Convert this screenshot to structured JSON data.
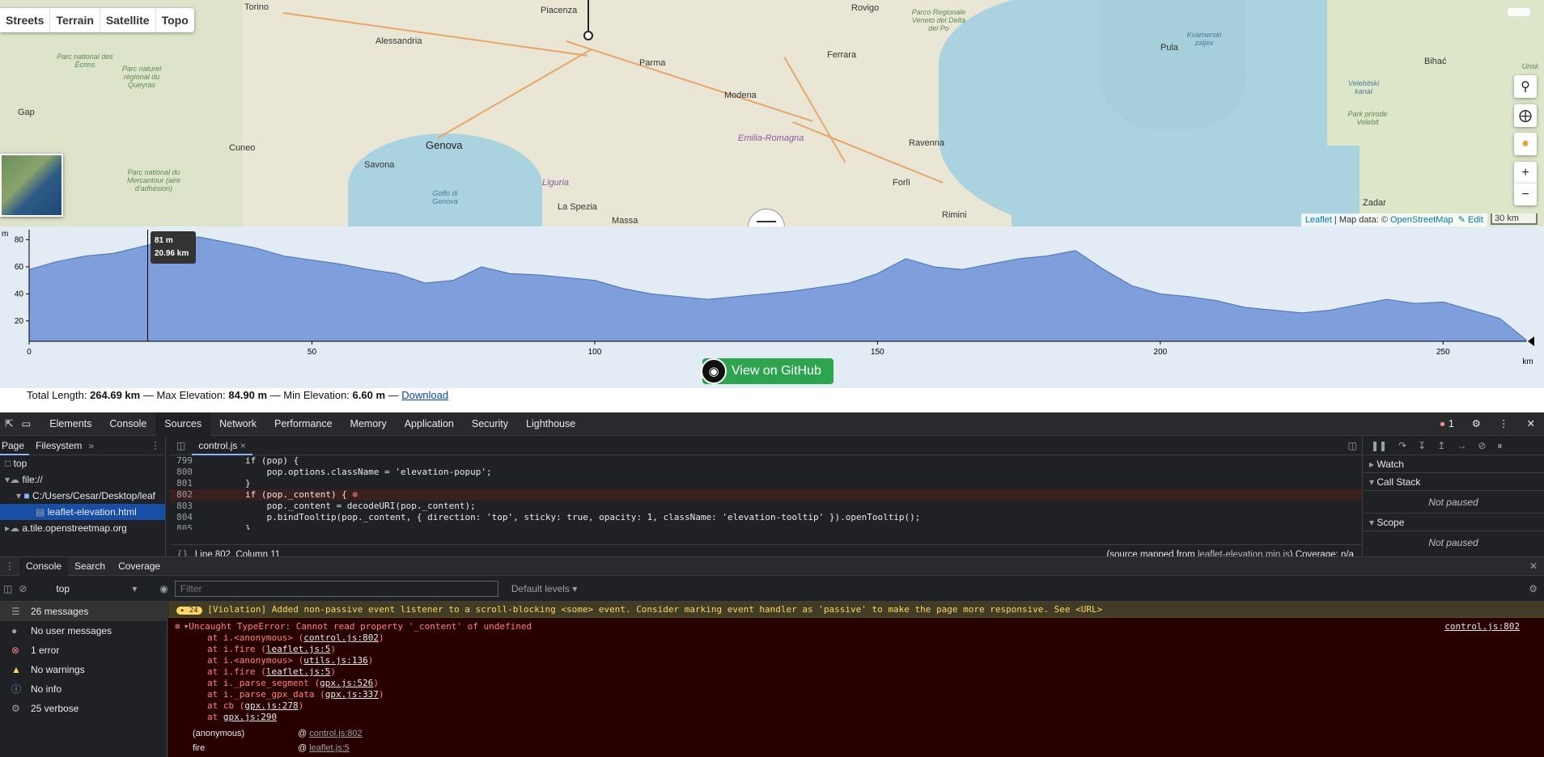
{
  "map": {
    "layers": [
      "Streets",
      "Terrain",
      "Satellite",
      "Topo"
    ],
    "cities": [
      {
        "name": "Torino"
      },
      {
        "name": "Piacenza"
      },
      {
        "name": "Rovigo"
      },
      {
        "name": "Alessandria"
      },
      {
        "name": "Parma"
      },
      {
        "name": "Ferrara"
      },
      {
        "name": "Modena"
      },
      {
        "name": "Genova"
      },
      {
        "name": "Ravenna"
      },
      {
        "name": "Savona"
      },
      {
        "name": "Cuneo"
      },
      {
        "name": "Forlì"
      },
      {
        "name": "La Spezia"
      },
      {
        "name": "Massa"
      },
      {
        "name": "Rimini"
      },
      {
        "name": "Pula"
      },
      {
        "name": "Zadar"
      },
      {
        "name": "Bihać"
      },
      {
        "name": "Gap"
      },
      {
        "name": "Emilia-Romagna"
      },
      {
        "name": "Liguria"
      }
    ],
    "parks": [
      "Parc national des Écrins",
      "Parc naturel régional du Queyras",
      "Parco Regionale Veneto del Delta del Po",
      "Parc national du Mercantour (aire d'adhésion)",
      "Golfo di Genova",
      "Kvarnerski zaljev",
      "Velebitski kanal",
      "Park prirode Velebit",
      "Unsk"
    ],
    "buttons": {
      "search": "search-icon",
      "locate": "locate-icon",
      "pegman": "pegman-icon",
      "zoom_in": "+",
      "zoom_out": "−"
    },
    "attribution": {
      "leaflet": "Leaflet",
      "sep1": " | Map data: © ",
      "osm": "OpenStreetMap",
      "edit": "✎ Edit"
    },
    "scale": "30 km"
  },
  "elevation": {
    "y_unit": "m",
    "x_unit": "km",
    "y_ticks": [
      "80",
      "60",
      "40",
      "20"
    ],
    "x_ticks": [
      "0",
      "50",
      "100",
      "150",
      "200",
      "250"
    ],
    "tooltip_elev": "81 m",
    "tooltip_dist": "20.96 km"
  },
  "chart_data": {
    "type": "area",
    "xlabel": "km",
    "ylabel": "m",
    "xlim": [
      0,
      264.69
    ],
    "ylim": [
      5,
      85
    ],
    "x": [
      0,
      5,
      10,
      15,
      20,
      25,
      30,
      35,
      40,
      45,
      50,
      55,
      60,
      65,
      70,
      75,
      80,
      85,
      90,
      95,
      100,
      105,
      110,
      115,
      120,
      125,
      130,
      135,
      140,
      145,
      150,
      155,
      160,
      165,
      170,
      175,
      180,
      185,
      190,
      195,
      200,
      205,
      210,
      215,
      220,
      225,
      230,
      235,
      240,
      245,
      250,
      255,
      260,
      264.69
    ],
    "y": [
      58,
      64,
      68,
      70,
      75,
      80,
      82,
      78,
      74,
      68,
      65,
      62,
      58,
      55,
      48,
      50,
      60,
      55,
      54,
      52,
      50,
      44,
      40,
      38,
      36,
      38,
      40,
      42,
      45,
      48,
      55,
      66,
      60,
      58,
      62,
      66,
      68,
      72,
      58,
      46,
      40,
      38,
      35,
      30,
      28,
      26,
      28,
      32,
      36,
      33,
      34,
      28,
      22,
      6
    ]
  },
  "github_button": "View on GitHub",
  "stats": {
    "total_label": "Total Length: ",
    "total": "264.69 km",
    "max_label": " — Max Elevation: ",
    "max": "84.90 m",
    "min_label": " — Min Elevation: ",
    "min": "6.60 m",
    "sep": " — ",
    "download": "Download"
  },
  "devtools": {
    "tabs": [
      "Elements",
      "Console",
      "Sources",
      "Network",
      "Performance",
      "Memory",
      "Application",
      "Security",
      "Lighthouse"
    ],
    "selected_tab": "Sources",
    "error_count": "1",
    "nav_tabs": [
      "Page",
      "Filesystem"
    ],
    "tree": [
      "top",
      "file://",
      "C:/Users/Cesar/Desktop/leaf",
      "leaflet-elevation.html",
      "a.tile.openstreetmap.org"
    ],
    "file_tab": "control.js",
    "code": [
      {
        "ln": "799",
        "text": "        if (pop) {"
      },
      {
        "ln": "800",
        "text": "            pop.options.className = 'elevation-popup';"
      },
      {
        "ln": "801",
        "text": "        }"
      },
      {
        "ln": "802",
        "text": "        if (pop._content) {"
      },
      {
        "ln": "803",
        "text": "            pop._content = decodeURI(pop._content);"
      },
      {
        "ln": "804",
        "text": "            p.bindTooltip(pop._content, { direction: 'top', sticky: true, opacity: 1, className: 'elevation-tooltip' }).openTooltip();"
      },
      {
        "ln": "805",
        "text": "        }"
      }
    ],
    "status": "Line 802, Column 11",
    "source_mapped_prefix": "(source mapped from ",
    "source_mapped_file": "leaflet-elevation.min.js",
    "source_mapped_suffix": ")  Coverage: n/a",
    "right_panel": {
      "watch": "Watch",
      "call_stack": "Call Stack",
      "not_paused": "Not paused",
      "scope": "Scope"
    },
    "drawer_tabs": [
      "Console",
      "Search",
      "Coverage"
    ],
    "context": "top",
    "filter_placeholder": "Filter",
    "levels": "Default levels ▾",
    "side_items": [
      "26 messages",
      "No user messages",
      "1 error",
      "No warnings",
      "No info",
      "25 verbose"
    ],
    "warn_count": "24",
    "violation": "[Violation] Added non-passive event listener to a scroll-blocking <some> event. Consider marking event handler as 'passive' to make the page more responsive. See <URL>",
    "error_title": "Uncaught TypeError: Cannot read property '_content' of undefined",
    "error_link": "control.js:802",
    "stack": [
      {
        "fn": "at i.<anonymous> (",
        "loc": "control.js:802",
        "end": ")"
      },
      {
        "fn": "at i.fire (",
        "loc": "leaflet.js:5",
        "end": ")"
      },
      {
        "fn": "at i.<anonymous> (",
        "loc": "utils.js:136",
        "end": ")"
      },
      {
        "fn": "at i.fire (",
        "loc": "leaflet.js:5",
        "end": ")"
      },
      {
        "fn": "at i._parse_segment (",
        "loc": "gpx.js:526",
        "end": ")"
      },
      {
        "fn": "at i._parse_gpx_data (",
        "loc": "gpx.js:337",
        "end": ")"
      },
      {
        "fn": "at cb (",
        "loc": "gpx.js:278",
        "end": ")"
      },
      {
        "fn": "at ",
        "loc": "gpx.js:290",
        "end": ""
      }
    ],
    "frames": [
      {
        "fn": "(anonymous)",
        "loc": "control.js:802"
      },
      {
        "fn": "fire",
        "loc": "leaflet.js:5"
      }
    ]
  }
}
